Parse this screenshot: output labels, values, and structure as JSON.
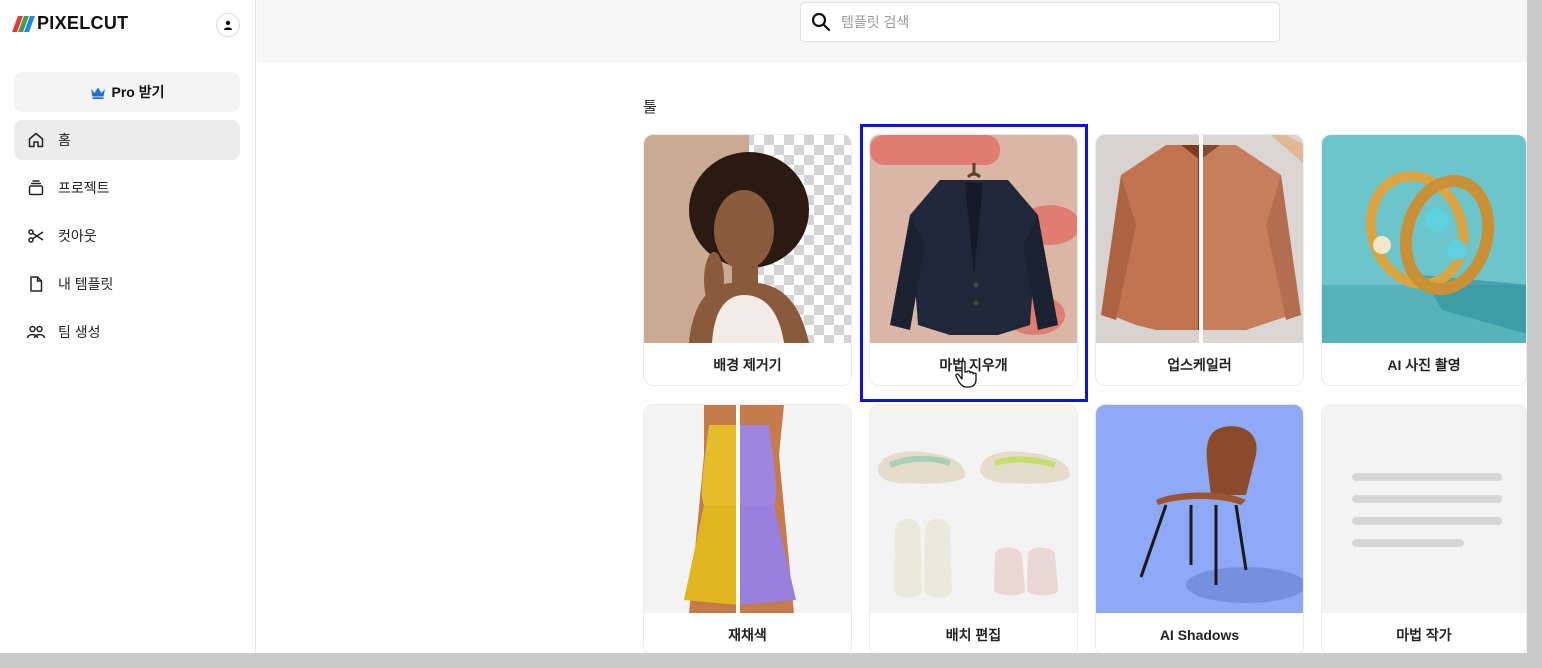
{
  "brand": {
    "name": "PIXELCUT"
  },
  "sidebar": {
    "pro_label": "Pro 받기",
    "items": [
      {
        "label": "홈",
        "icon": "home-icon",
        "active": true
      },
      {
        "label": "프로젝트",
        "icon": "projects-icon"
      },
      {
        "label": "컷아웃",
        "icon": "scissors-icon"
      },
      {
        "label": "내 템플릿",
        "icon": "file-icon"
      },
      {
        "label": "팀 생성",
        "icon": "team-icon"
      }
    ]
  },
  "search": {
    "placeholder": "템플릿 검색",
    "value": ""
  },
  "tools": {
    "title": "툴",
    "cards": [
      {
        "label": "배경 제거기"
      },
      {
        "label": "마법 지우개"
      },
      {
        "label": "업스케일러"
      },
      {
        "label": "AI 사진 촬영"
      },
      {
        "label": "재채색"
      },
      {
        "label": "배치 편집"
      },
      {
        "label": "AI Shadows"
      },
      {
        "label": "마법 작가"
      }
    ]
  },
  "colors": {
    "accent": "#1111dd",
    "pro_crown": "#1e6fd9"
  }
}
